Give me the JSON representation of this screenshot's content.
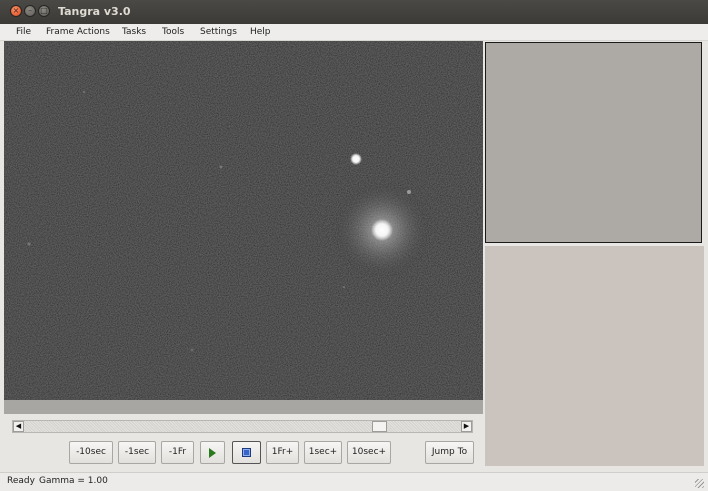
{
  "window": {
    "title": "Tangra v3.0"
  },
  "menu": [
    "File",
    "Frame Actions",
    "Tasks",
    "Tools",
    "Settings",
    "Help"
  ],
  "controls": {
    "back_10sec": "-10sec",
    "back_1sec": "-1sec",
    "back_1frame": "-1Fr",
    "play_icon": "play-icon",
    "stop_icon": "stop-icon",
    "fwd_1frame": "1Fr+",
    "fwd_1sec": "1sec+",
    "fwd_10sec": "10sec+",
    "jump_to": "Jump To"
  },
  "scrollbar": {
    "position_fraction": 0.82
  },
  "status": {
    "state": "Ready",
    "gamma": "Gamma = 1.00"
  },
  "colors": {
    "titlebar": "#3c3b37",
    "play_green": "#2c7a20",
    "stop_blue": "#3a64c8",
    "panel_top": "#adaaa5",
    "panel_bottom": "#cbc3be"
  }
}
